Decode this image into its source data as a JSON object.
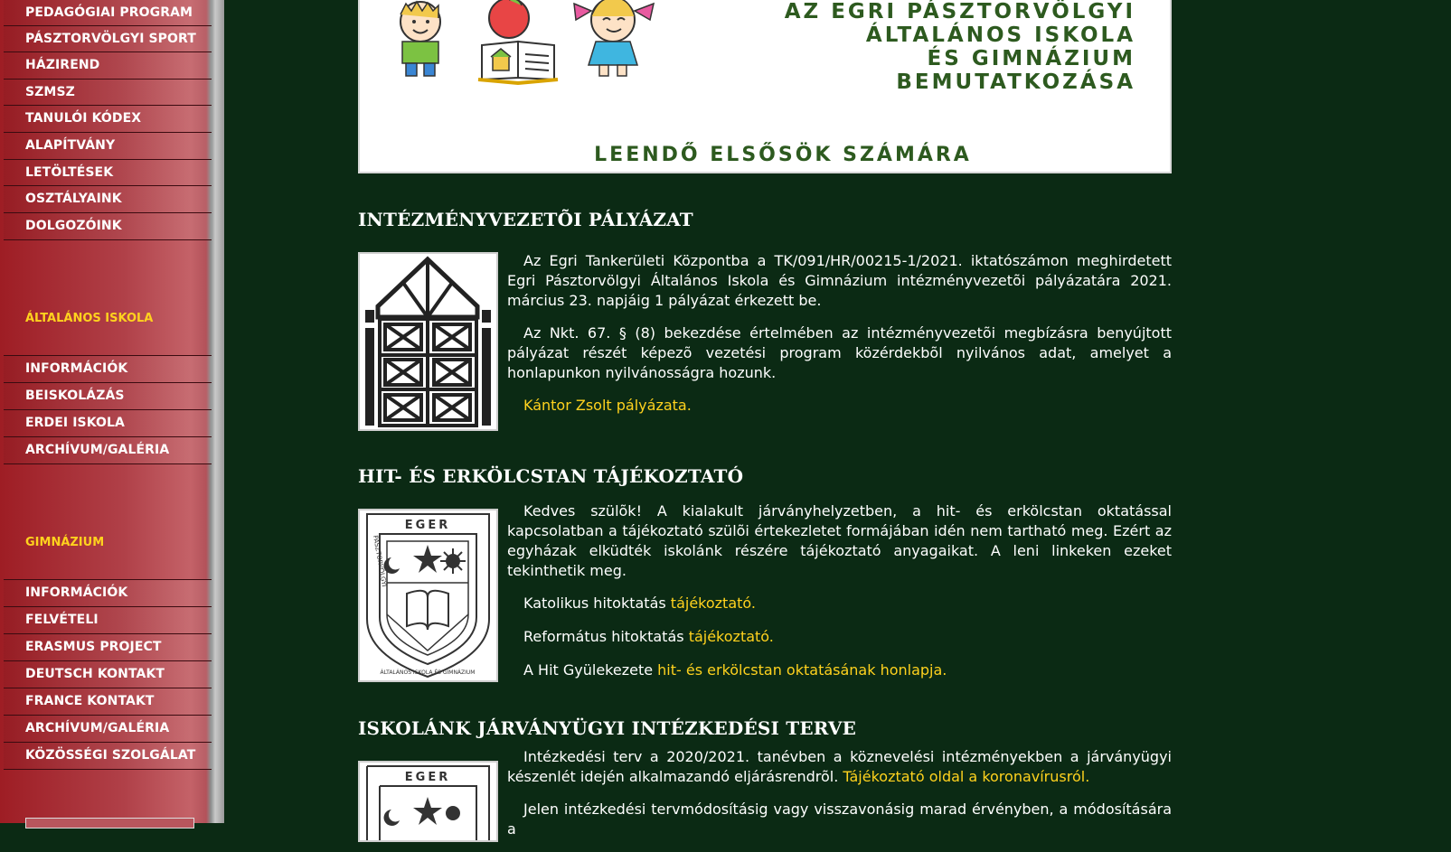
{
  "sidebar": {
    "top_items": [
      {
        "label": "PEDAGÓGIAI PROGRAM"
      },
      {
        "label": "PÁSZTORVÖLGYI SPORT"
      },
      {
        "label": "HÁZIREND"
      },
      {
        "label": "SZMSZ"
      },
      {
        "label": "TANULÓI KÓDEX"
      },
      {
        "label": "ALAPÍTVÁNY"
      },
      {
        "label": "LETÖLTÉSEK"
      },
      {
        "label": "OSZTÁLYAINK"
      },
      {
        "label": "DOLGOZÓINK"
      }
    ],
    "section_elementary": "ÁLTALÁNOS ISKOLA",
    "elementary_items": [
      {
        "label": "INFORMÁCIÓK"
      },
      {
        "label": "BEISKOLÁZÁS"
      },
      {
        "label": "ERDEI ISKOLA"
      },
      {
        "label": "ARCHÍVUM/GALÉRIA"
      }
    ],
    "section_gymnasium": "GIMNÁZIUM",
    "gymnasium_items": [
      {
        "label": "INFORMÁCIÓK"
      },
      {
        "label": "FELVÉTELI"
      },
      {
        "label": "ERASMUS PROJECT"
      },
      {
        "label": "DEUTSCH KONTAKT"
      },
      {
        "label": "FRANCE KONTAKT"
      },
      {
        "label": "ARCHÍVUM/GALÉRIA"
      },
      {
        "label": "KÖZÖSSÉGI SZOLGÁLAT"
      }
    ]
  },
  "banner": {
    "title_lines": [
      "AZ EGRI PÁSZTORVÖLGYI",
      "ÁLTALÁNOS ISKOLA",
      "ÉS GIMNÁZIUM",
      "BEMUTATKOZÁSA"
    ],
    "subtitle": "LEENDŐ ELSŐSÖK SZÁMÁRA"
  },
  "articles": [
    {
      "title": "INTÉZMÉNYVEZETÕI PÁLYÁZAT",
      "p1": "Az Egri Tankerületi Központba a TK/091/HR/00215-1/2021. iktatószámon meghirdetett Egri Pásztorvölgyi Általános Iskola és Gimnázium intézményvezetõi pályázatára 2021. március 23. napjáig 1 pályázat érkezett be.",
      "p2": "Az Nkt. 67. § (8) bekezdése értelmében az intézményvezetõi megbízásra benyújtott pályázat részét képezõ vezetési program közérdekbõl nyilvános adat, amelyet a honlapunkon nyilvánosságra hozunk.",
      "link": "Kántor Zsolt pályázata."
    },
    {
      "title": "HIT- ÉS ERKÖLCSTAN TÁJÉKOZTATÓ",
      "p1": "Kedves szülõk! A kialakult járványhelyzetben, a hit- és erkölcstan oktatással kapcsolatban a tájékoztató szülõi értekezletet formájában idén nem tartható meg. Ezért az egyházak elküdték iskolánk részére tájékoztató anyagaikat. A leni linkeken ezeket tekinthetik meg.",
      "line1_text": "Katolikus hitoktatás ",
      "line1_link": "tájékoztató.",
      "line2_text": "Református hitoktatás ",
      "line2_link": "tájékoztató.",
      "line3_text": "A Hit Gyülekezete ",
      "line3_link": "hit- és erkölcstan oktatásának honlapja."
    },
    {
      "title": "ISKOLÁNK JÁRVÁNYÜGYI INTÉZKEDÉSI TERVE",
      "p1_text": "Intézkedési terv a 2020/2021. tanévben a köznevelési intézményekben a járványügyi készenlét idején alkalmazandó eljárásrendrõl. ",
      "p1_link": "Tájékoztató oldal a koronavírusról.",
      "p2": "Jelen intézkedési tervmódosításig vagy visszavonásig marad érvényben, a módosítására a"
    }
  ],
  "emblem": {
    "top_text": "EGER",
    "left_text": "PÁSZTORVÖLGYI",
    "bottom_text": "ÁLTALÁNOS ISKOLA ÉS GIMNÁZIUM"
  },
  "colors": {
    "background": "#0b2a14",
    "sidebar": "#a8343c",
    "accent_yellow": "#ffd21e",
    "banner_green": "#2d5a1f"
  }
}
